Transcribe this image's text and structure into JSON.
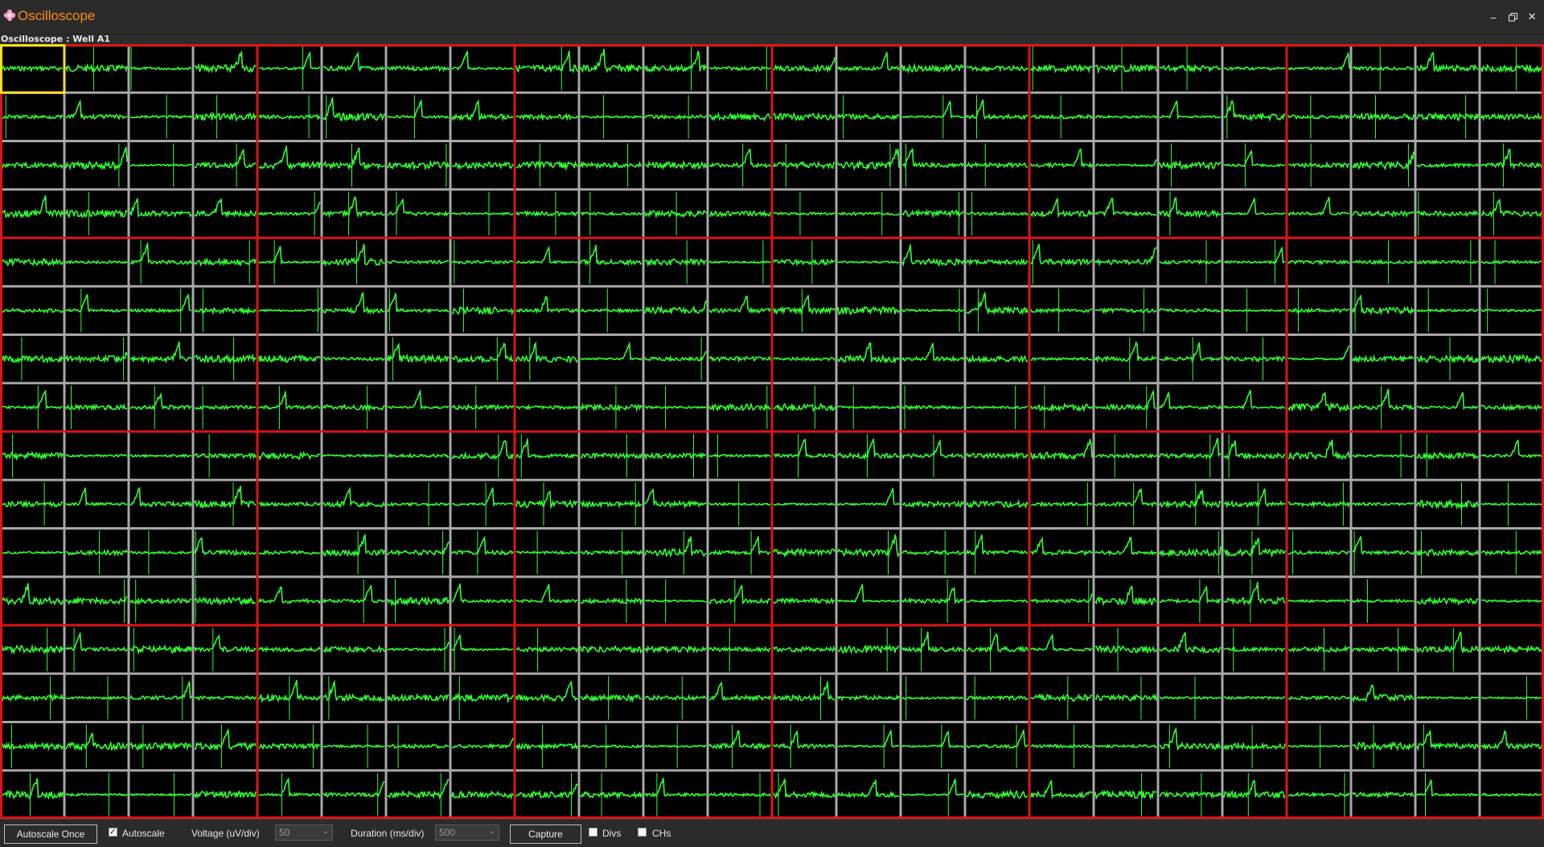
{
  "window": {
    "title": "Oscilloscope",
    "controls": [
      "minimize-icon",
      "restore-icon",
      "close-icon"
    ]
  },
  "section_label": "Oscilloscope : Well A1",
  "scope": {
    "wells_per_row": 6,
    "well_rows": 4,
    "channels_per_side": 4,
    "trace_color": "#33ff33",
    "grid_color": "#a8a8a8",
    "well_border_color": "#e01414",
    "selected_color": "#ffe020",
    "background": "#000000",
    "selected_channel": "Well A1 channel 1"
  },
  "toolbar": {
    "autoscale_once_label": "Autoscale Once",
    "autoscale_label": "Autoscale",
    "autoscale_checked": true,
    "voltage_label": "Voltage (uV/div)",
    "voltage_value": "50",
    "duration_label": "Duration (ms/div)",
    "duration_value": "500",
    "capture_label": "Capture",
    "divs_label": "Divs",
    "divs_checked": false,
    "chs_label": "CHs",
    "chs_checked": false
  }
}
